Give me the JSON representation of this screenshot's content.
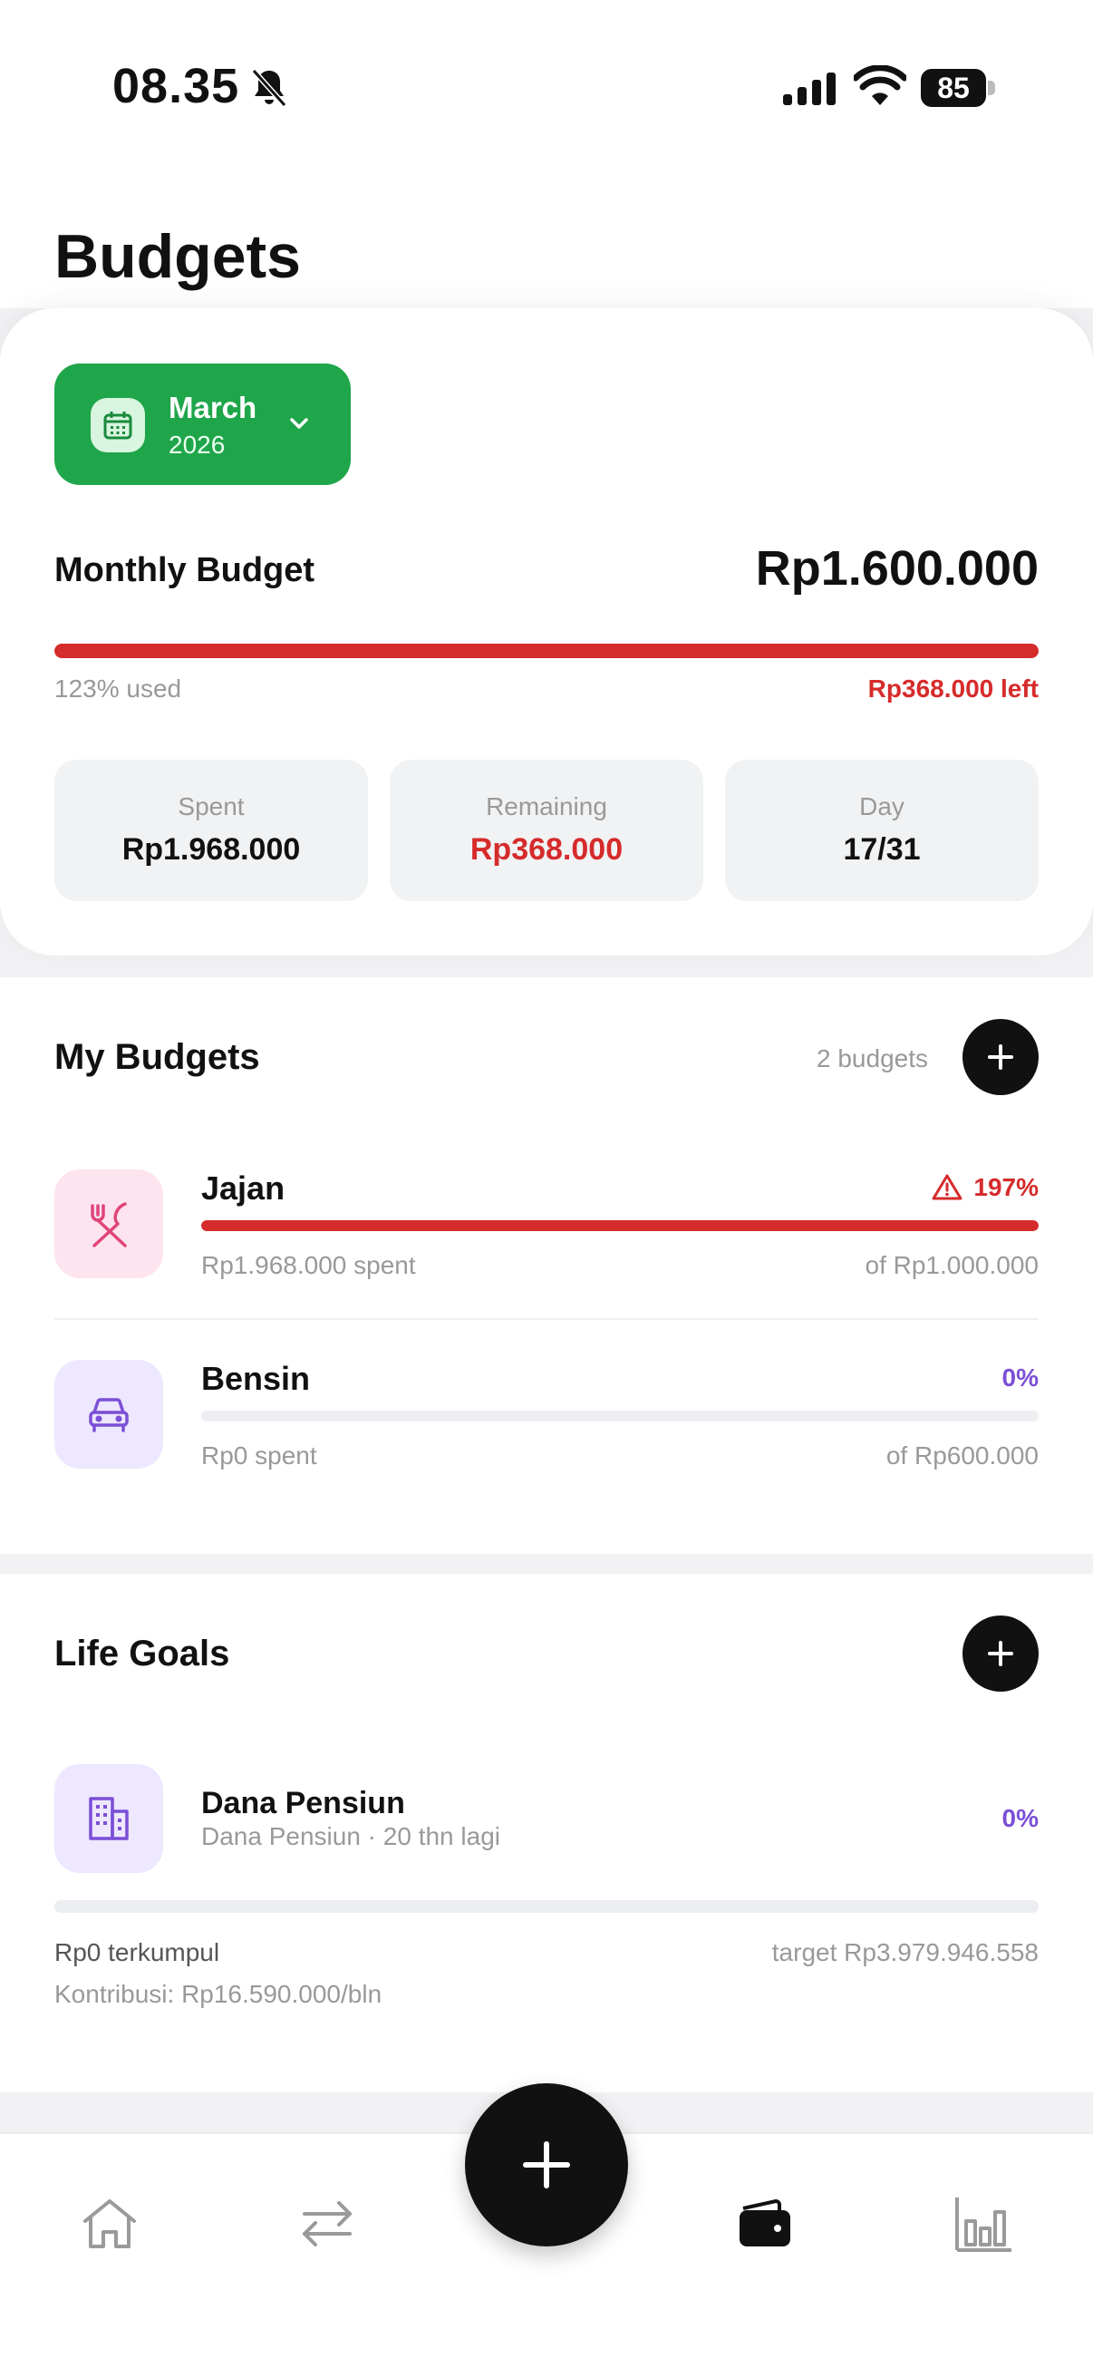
{
  "status_bar": {
    "time": "08.35",
    "battery": "85"
  },
  "page": {
    "title": "Budgets"
  },
  "month_selector": {
    "month": "March",
    "year": "2026"
  },
  "monthly_budget": {
    "label": "Monthly Budget",
    "amount": "Rp1.600.000",
    "used_text": "123% used",
    "used_fraction": 1.0,
    "left_text": "Rp368.000 left"
  },
  "stats": [
    {
      "label": "Spent",
      "value": "Rp1.968.000"
    },
    {
      "label": "Remaining",
      "value": "Rp368.000"
    },
    {
      "label": "Day",
      "value": "17/31"
    }
  ],
  "my_budgets": {
    "title": "My Budgets",
    "count": "2 budgets",
    "items": [
      {
        "name": "Jajan",
        "percent": "197%",
        "progress": 1.0,
        "spent": "Rp1.968.000 spent",
        "of": "of Rp1.000.000",
        "icon": "fork-knife-icon",
        "color": "#e0447a",
        "bg": "#fde4ee",
        "pct_color": "#d62b2b"
      },
      {
        "name": "Bensin",
        "percent": "0%",
        "progress": 0.0,
        "spent": "Rp0 spent",
        "of": "of Rp600.000",
        "icon": "car-icon",
        "color": "#7b4fd6",
        "bg": "#ede7ff",
        "pct_color": "#7b4fd6"
      }
    ]
  },
  "life_goals": {
    "title": "Life Goals",
    "items": [
      {
        "name": "Dana Pensiun",
        "subtitle": "Dana Pensiun · 20 thn lagi",
        "percent": "0%",
        "progress": 0.0,
        "collected": "Rp0 terkumpul",
        "target": "target Rp3.979.946.558",
        "contribution": "Kontribusi: Rp16.590.000/bln",
        "icon": "building-icon"
      }
    ]
  },
  "colors": {
    "accent_green": "#1fa64a",
    "danger": "#d62b2b",
    "purple": "#7b4fd6"
  },
  "tabbar": {
    "items": [
      "home-icon",
      "transfer-icon",
      "add-icon",
      "wallet-icon",
      "stats-icon"
    ],
    "active": "wallet-icon"
  }
}
